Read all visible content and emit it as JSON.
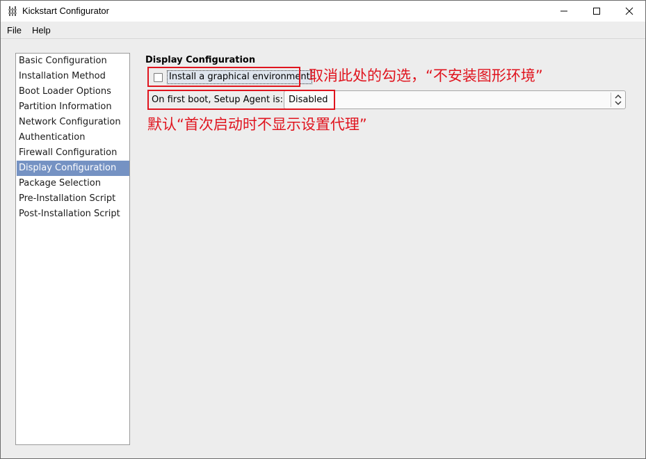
{
  "window": {
    "title": "Kickstart Configurator",
    "icon": "kickstart-app-icon"
  },
  "menubar": {
    "file": "File",
    "help": "Help"
  },
  "sidebar": {
    "items": [
      {
        "label": "Basic Configuration",
        "selected": false
      },
      {
        "label": "Installation Method",
        "selected": false
      },
      {
        "label": "Boot Loader Options",
        "selected": false
      },
      {
        "label": "Partition Information",
        "selected": false
      },
      {
        "label": "Network Configuration",
        "selected": false
      },
      {
        "label": "Authentication",
        "selected": false
      },
      {
        "label": "Firewall Configuration",
        "selected": false
      },
      {
        "label": "Display Configuration",
        "selected": true
      },
      {
        "label": "Package Selection",
        "selected": false
      },
      {
        "label": "Pre-Installation Script",
        "selected": false
      },
      {
        "label": "Post-Installation Script",
        "selected": false
      }
    ]
  },
  "main": {
    "section_title": "Display Configuration",
    "graphical_checkbox": {
      "label": "Install a graphical environment",
      "checked": false
    },
    "setup_agent": {
      "label": "On first boot, Setup Agent is:",
      "value": "Disabled"
    }
  },
  "annotations": {
    "note1": "取消此处的勾选，“不安装图形环境”",
    "note2": "默认“首次启动时不显示设置代理”",
    "color": "#e0141e"
  },
  "colors": {
    "selection": "#7592c3",
    "background": "#ededed"
  }
}
